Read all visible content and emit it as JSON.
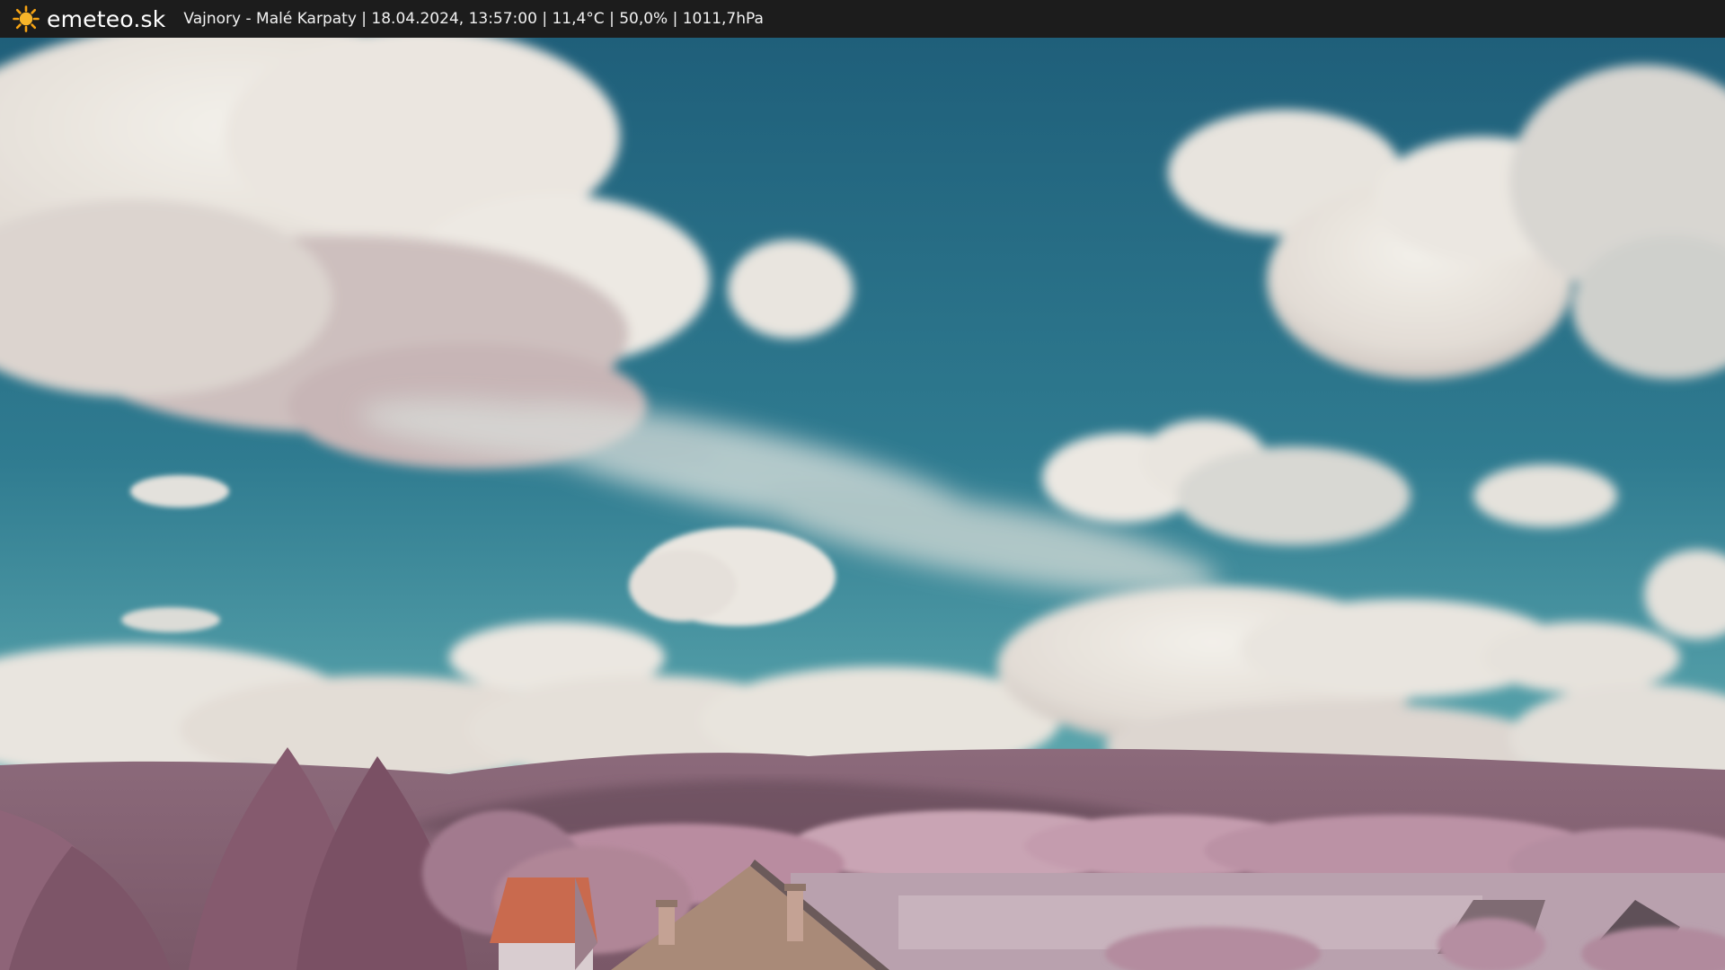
{
  "header": {
    "brand": "emeteo.sk",
    "status": "Vajnory - Malé Karpaty | 18.04.2024, 13:57:00 | 11,4°C | 50,0% | 1011,7hPa",
    "logo_icon": "sun-icon",
    "logo_color": "#f6a313"
  },
  "scene": {
    "description_colors": {
      "sky_top": "#2a6d84",
      "sky_bottom": "#4b9aa6",
      "cloud": "#ece8e2",
      "hills": "#8a6475",
      "foliage": "#b98a9e",
      "roof": "#c96a4e"
    }
  }
}
